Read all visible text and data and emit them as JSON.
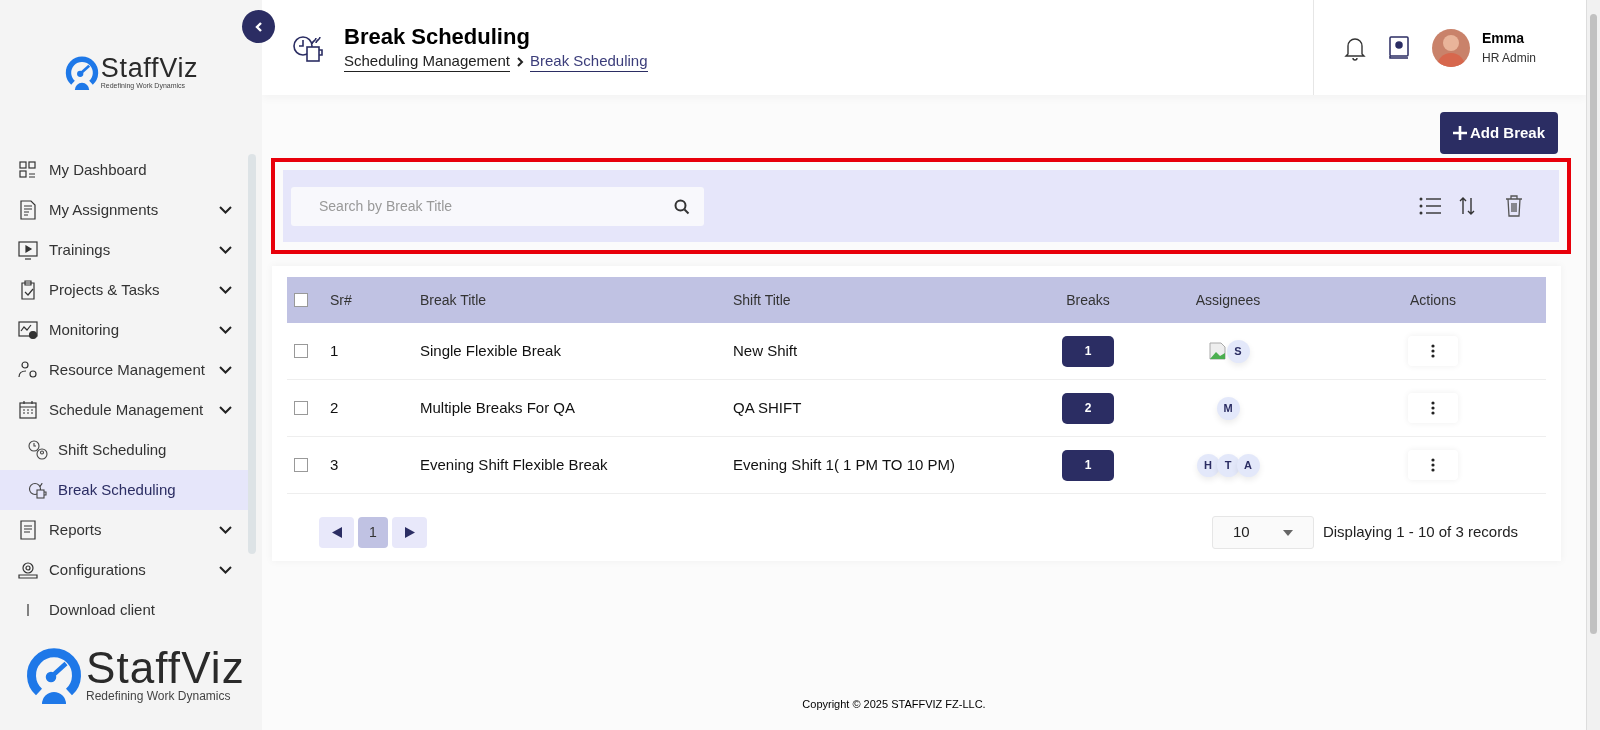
{
  "sidebar": {
    "logo": {
      "name": "StaffViz",
      "tagline": "Redefining Work Dynamics"
    },
    "items": [
      {
        "label": "My Dashboard",
        "has_submenu": false,
        "selected": false
      },
      {
        "label": "My Assignments",
        "has_submenu": true,
        "selected": false
      },
      {
        "label": "Trainings",
        "has_submenu": true,
        "selected": false
      },
      {
        "label": "Projects & Tasks",
        "has_submenu": true,
        "selected": false
      },
      {
        "label": "Monitoring",
        "has_submenu": true,
        "selected": false
      },
      {
        "label": "Resource Management",
        "has_submenu": true,
        "selected": false
      },
      {
        "label": "Schedule Management",
        "has_submenu": true,
        "selected": false,
        "children": [
          {
            "label": "Shift Scheduling",
            "selected": false
          },
          {
            "label": "Break Scheduling",
            "selected": true
          }
        ]
      },
      {
        "label": "Reports",
        "has_submenu": true,
        "selected": false
      },
      {
        "label": "Configurations",
        "has_submenu": true,
        "selected": false
      },
      {
        "label": "Download client",
        "has_submenu": false,
        "selected": false
      }
    ],
    "footer_logo": {
      "name": "StaffViz",
      "tagline": "Redefining Work Dynamics"
    }
  },
  "header": {
    "title": "Break Scheduling",
    "breadcrumb": [
      "Scheduling Management",
      "Break Scheduling"
    ],
    "user": {
      "name": "Emma",
      "role": "HR Admin"
    }
  },
  "add_button": "Add Break",
  "toolbar": {
    "highlighted": true,
    "search": {
      "placeholder": "Search by Break Title"
    }
  },
  "table": {
    "select_all_checked": false,
    "columns": [
      "Sr#",
      "Break Title",
      "Shift Title",
      "Breaks",
      "Assignees",
      "Actions"
    ],
    "rows": [
      {
        "checked": false,
        "sr": "1",
        "break_title": "Single Flexible Break",
        "shift_title": "New Shift",
        "breaks": "1",
        "assignees": [
          {
            "kind": "broken-image"
          },
          {
            "kind": "initial",
            "text": "S"
          }
        ]
      },
      {
        "checked": false,
        "sr": "2",
        "break_title": "Multiple Breaks For QA",
        "shift_title": "QA SHIFT",
        "breaks": "2",
        "assignees": [
          {
            "kind": "initial",
            "text": "M"
          }
        ]
      },
      {
        "checked": false,
        "sr": "3",
        "break_title": "Evening Shift Flexible Break",
        "shift_title": "Evening Shift 1( 1 PM TO 10 PM)",
        "breaks": "1",
        "assignees": [
          {
            "kind": "initial",
            "text": "H"
          },
          {
            "kind": "initial",
            "text": "T"
          },
          {
            "kind": "initial",
            "text": "A"
          }
        ]
      }
    ]
  },
  "pagination": {
    "pages": [
      {
        "label": "1",
        "selected": true
      }
    ],
    "page_size": "10",
    "summary": "Displaying 1 - 10 of 3 records"
  },
  "footer": "Copyright © 2025 STAFFVIZ FZ-LLC."
}
